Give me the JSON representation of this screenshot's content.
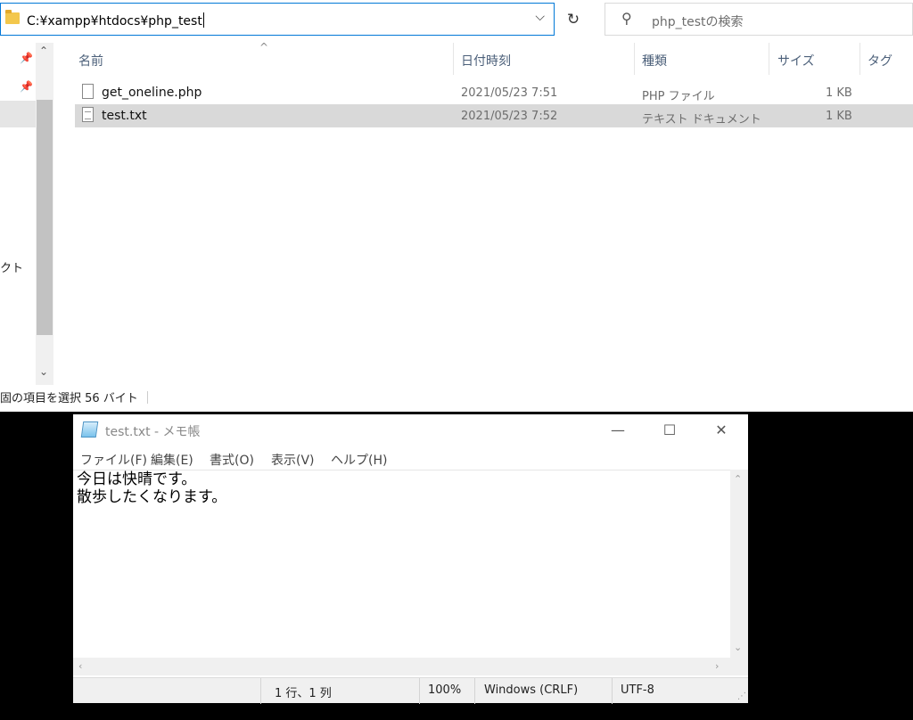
{
  "explorer": {
    "address_path": "C:¥xampp¥htdocs¥php_test",
    "search_placeholder": "php_testの検索",
    "columns": [
      "名前",
      "日付時刻",
      "種類",
      "サイズ",
      "タグ"
    ],
    "files": [
      {
        "name": "get_oneline.php",
        "date": "2021/05/23 7:51",
        "type": "PHP ファイル",
        "size": "1 KB",
        "icon": "php-file-icon"
      },
      {
        "name": "test.txt",
        "date": "2021/05/23 7:52",
        "type": "テキスト ドキュメント",
        "size": "1 KB",
        "icon": "text-file-icon",
        "selected": true
      }
    ],
    "nav_partial_label": "クト",
    "status_text": "固の項目を選択  56 バイト"
  },
  "notepad": {
    "title": "test.txt - メモ帳",
    "menu": [
      "ファイル(F)",
      "編集(E)",
      "書式(O)",
      "表示(V)",
      "ヘルプ(H)"
    ],
    "content": "今日は快晴です。\n散歩したくなります。",
    "status": {
      "position": "1 行、1 列",
      "zoom": "100%",
      "line_ending": "Windows (CRLF)",
      "encoding": "UTF-8"
    }
  },
  "colors": {
    "selection": "#d9d9d9",
    "address_border": "#0078d7",
    "header_text": "#4c607a"
  }
}
